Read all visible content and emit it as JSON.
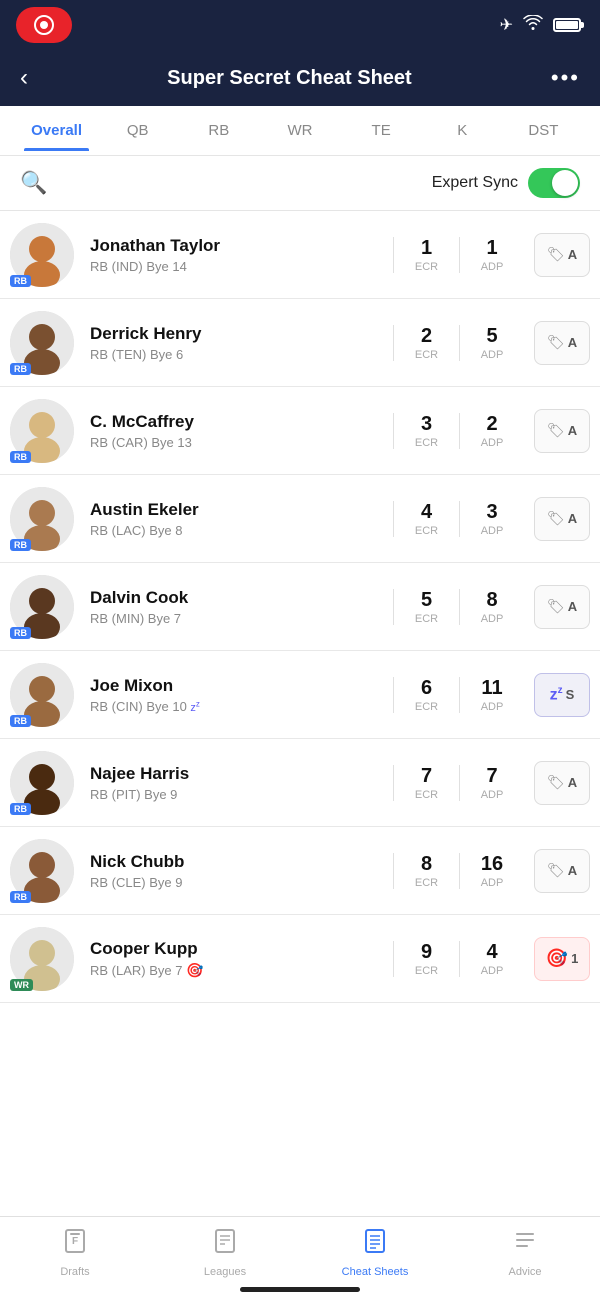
{
  "statusBar": {
    "recordLabel": "REC"
  },
  "navBar": {
    "title": "Super Secret Cheat Sheet",
    "backLabel": "‹",
    "moreLabel": "•••"
  },
  "tabs": [
    {
      "id": "overall",
      "label": "Overall",
      "active": true
    },
    {
      "id": "qb",
      "label": "QB",
      "active": false
    },
    {
      "id": "rb",
      "label": "RB",
      "active": false
    },
    {
      "id": "wr",
      "label": "WR",
      "active": false
    },
    {
      "id": "te",
      "label": "TE",
      "active": false
    },
    {
      "id": "k",
      "label": "K",
      "active": false
    },
    {
      "id": "dst",
      "label": "DST",
      "active": false
    }
  ],
  "search": {
    "placeholder": "Search"
  },
  "expertSync": {
    "label": "Expert Sync",
    "enabled": true
  },
  "players": [
    {
      "id": 1,
      "name": "Jonathan Taylor",
      "meta": "RB (IND) Bye 14",
      "position": "RB",
      "positionColor": "rb",
      "ecr": 1,
      "adp": 1,
      "action": "tag",
      "actionLetter": "A",
      "sleepMode": false,
      "targeted": false,
      "avatarColor": "#b85c2a"
    },
    {
      "id": 2,
      "name": "Derrick Henry",
      "meta": "RB (TEN) Bye 6",
      "position": "RB",
      "positionColor": "rb",
      "ecr": 2,
      "adp": 5,
      "action": "tag",
      "actionLetter": "A",
      "sleepMode": false,
      "targeted": false,
      "avatarColor": "#5a3a1a"
    },
    {
      "id": 3,
      "name": "C. McCaffrey",
      "meta": "RB (CAR) Bye 13",
      "position": "RB",
      "positionColor": "rb",
      "ecr": 3,
      "adp": 2,
      "action": "tag",
      "actionLetter": "A",
      "sleepMode": false,
      "targeted": false,
      "avatarColor": "#c8a070"
    },
    {
      "id": 4,
      "name": "Austin Ekeler",
      "meta": "RB (LAC) Bye 8",
      "position": "RB",
      "positionColor": "rb",
      "ecr": 4,
      "adp": 3,
      "action": "tag",
      "actionLetter": "A",
      "sleepMode": false,
      "targeted": false,
      "avatarColor": "#8a5a30"
    },
    {
      "id": 5,
      "name": "Dalvin Cook",
      "meta": "RB (MIN) Bye 7",
      "position": "RB",
      "positionColor": "rb",
      "ecr": 5,
      "adp": 8,
      "action": "tag",
      "actionLetter": "A",
      "sleepMode": false,
      "targeted": false,
      "avatarColor": "#3a2010"
    },
    {
      "id": 6,
      "name": "Joe Mixon",
      "meta": "RB (CIN) Bye 10",
      "position": "RB",
      "positionColor": "rb",
      "ecr": 6,
      "adp": 11,
      "action": "sleep",
      "actionLetter": "S",
      "sleepMode": true,
      "targeted": false,
      "avatarColor": "#7a4a20",
      "hasSleep": true
    },
    {
      "id": 7,
      "name": "Najee Harris",
      "meta": "RB (PIT) Bye 9",
      "position": "RB",
      "positionColor": "rb",
      "ecr": 7,
      "adp": 7,
      "action": "tag",
      "actionLetter": "A",
      "sleepMode": false,
      "targeted": false,
      "avatarColor": "#2a1a0a"
    },
    {
      "id": 8,
      "name": "Nick Chubb",
      "meta": "RB (CLE) Bye 9",
      "position": "RB",
      "positionColor": "rb",
      "ecr": 8,
      "adp": 16,
      "action": "tag",
      "actionLetter": "A",
      "sleepMode": false,
      "targeted": false,
      "avatarColor": "#6a3a18"
    },
    {
      "id": 9,
      "name": "Cooper Kupp",
      "meta": "RB (LAR) Bye 7",
      "position": "WR",
      "positionColor": "wr",
      "ecr": 9,
      "adp": 4,
      "action": "target",
      "actionLetter": "1",
      "sleepMode": false,
      "targeted": true,
      "avatarColor": "#c0a878",
      "hasTarget": true
    }
  ],
  "bottomNav": {
    "items": [
      {
        "id": "drafts",
        "label": "Drafts",
        "active": false,
        "icon": "drafts"
      },
      {
        "id": "leagues",
        "label": "Leagues",
        "active": false,
        "icon": "leagues"
      },
      {
        "id": "cheatsheets",
        "label": "Cheat Sheets",
        "active": true,
        "icon": "cheatsheets"
      },
      {
        "id": "advice",
        "label": "Advice",
        "active": false,
        "icon": "advice"
      }
    ]
  }
}
